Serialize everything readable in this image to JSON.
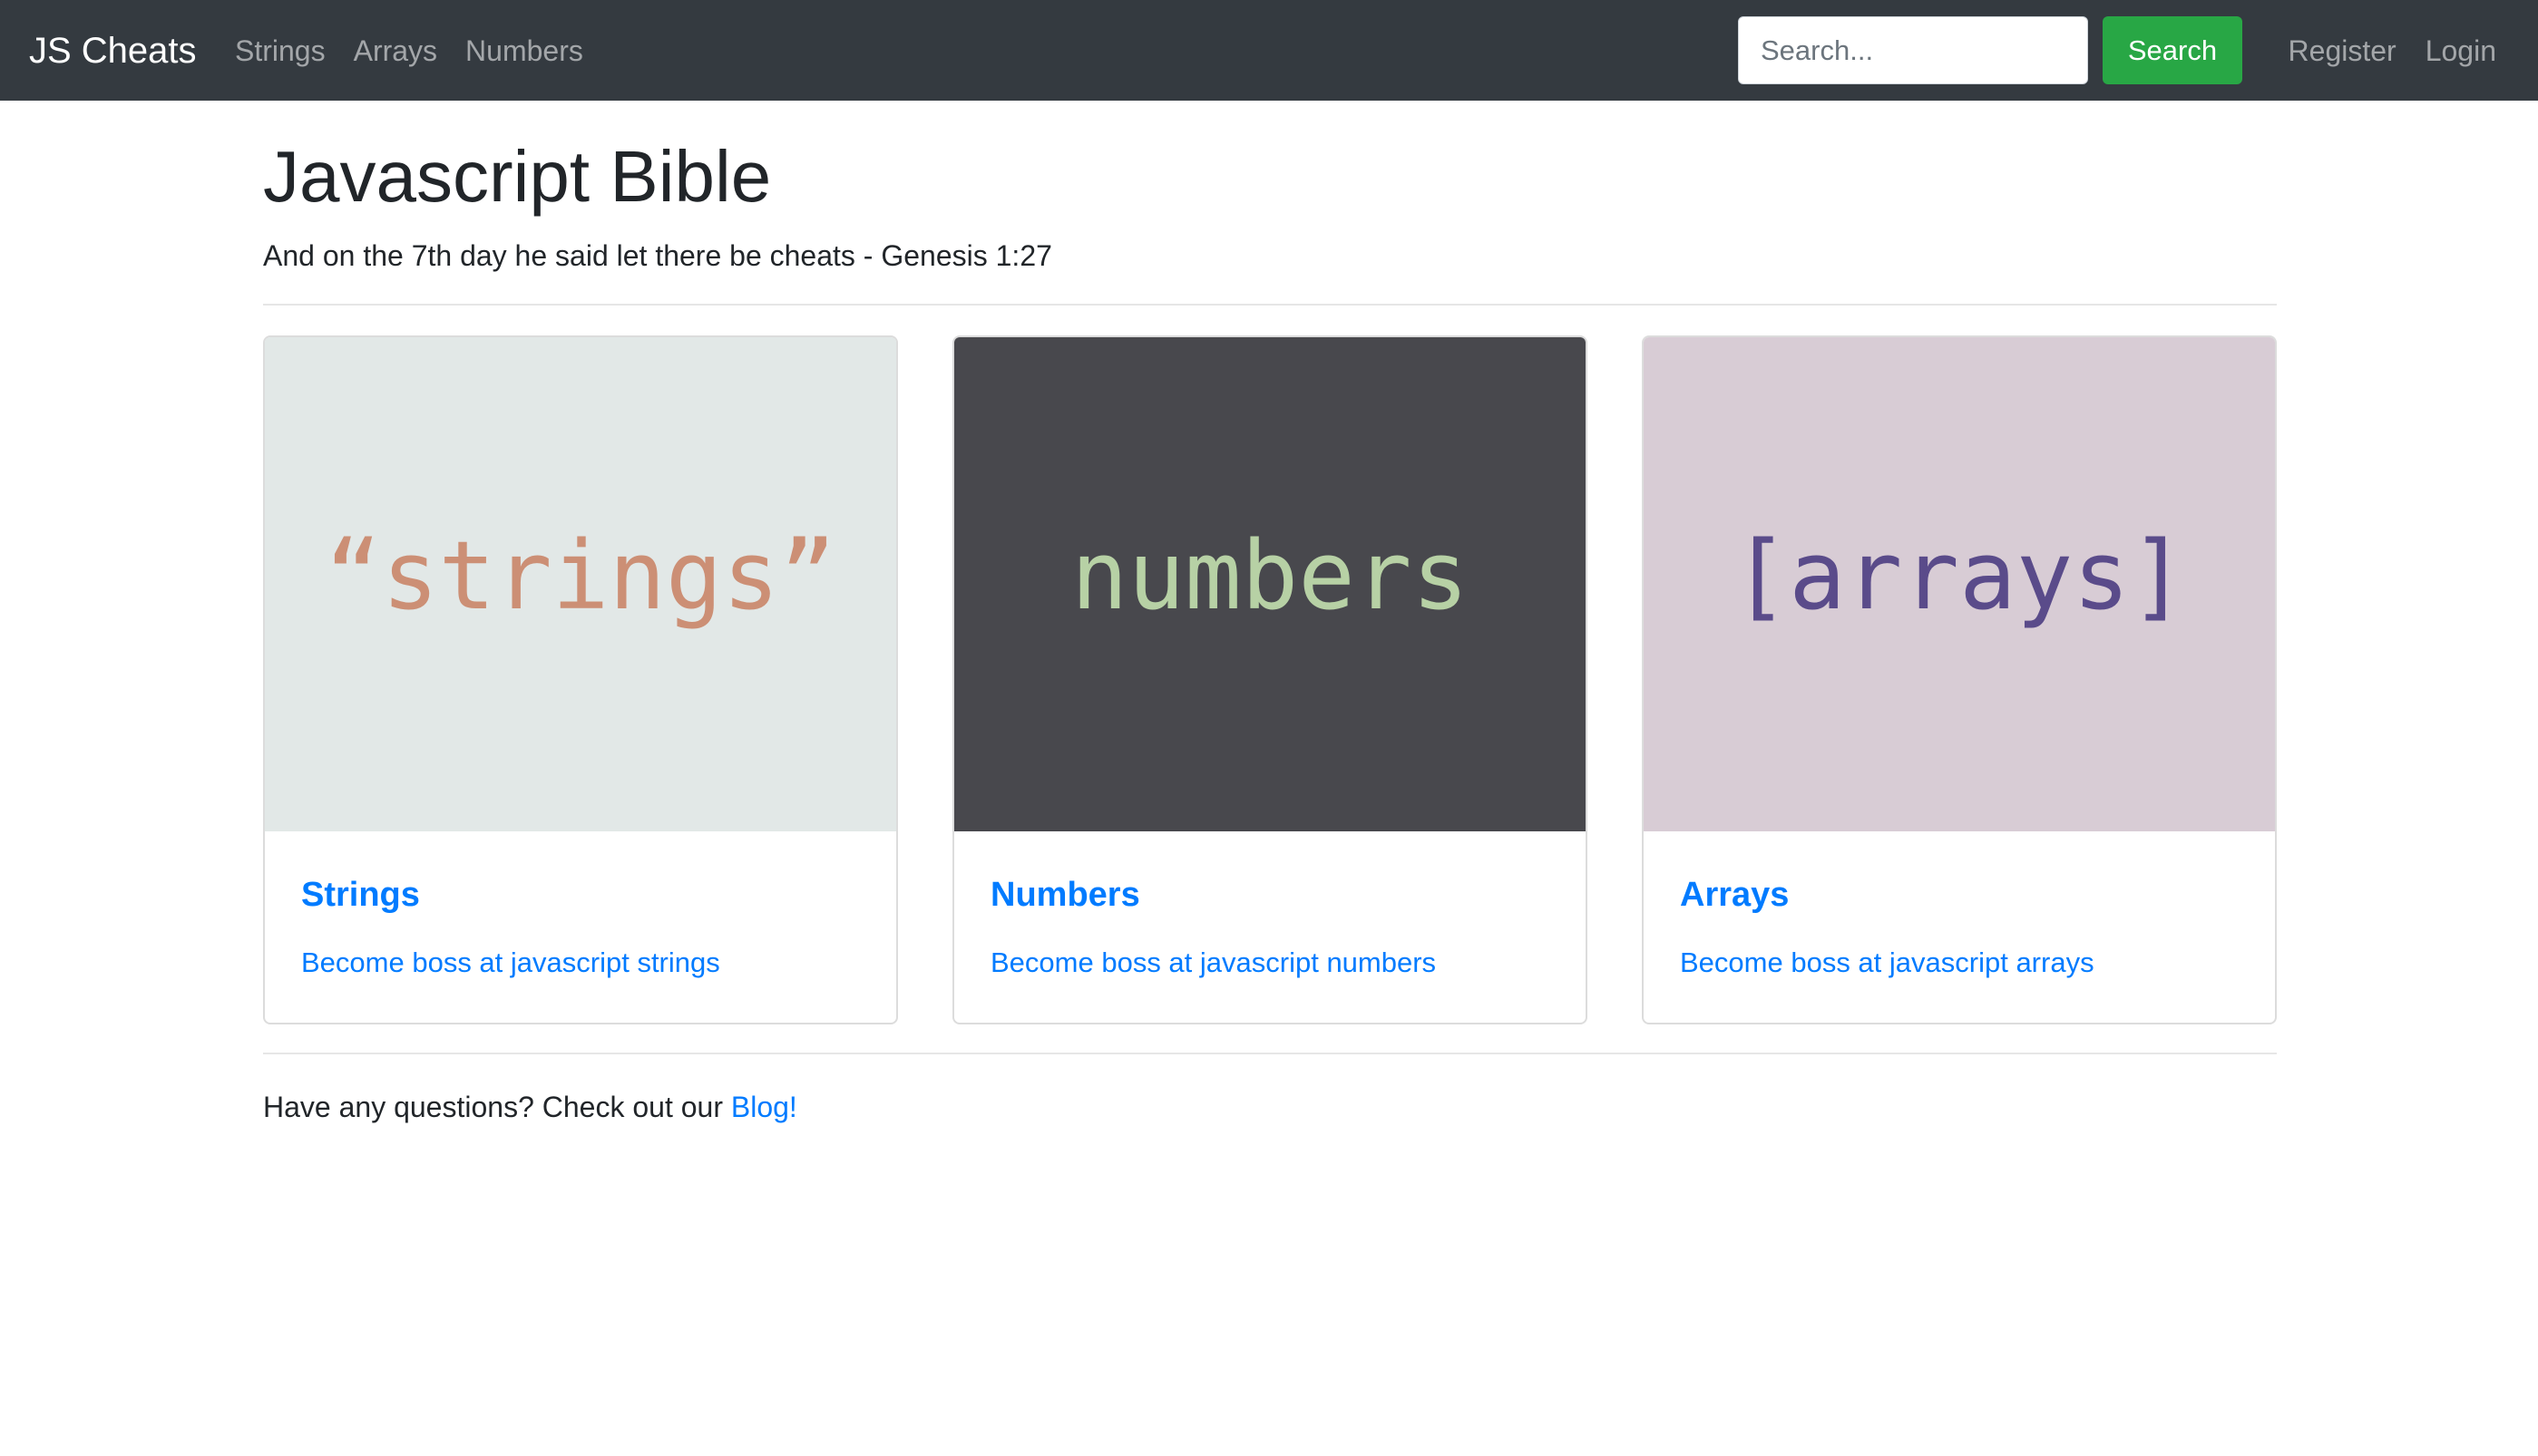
{
  "navbar": {
    "brand": "JS Cheats",
    "links": [
      {
        "label": "Strings"
      },
      {
        "label": "Arrays"
      },
      {
        "label": "Numbers"
      }
    ],
    "search": {
      "placeholder": "Search...",
      "value": "",
      "button_label": "Search"
    },
    "auth": {
      "register_label": "Register",
      "login_label": "Login"
    },
    "colors": {
      "background": "#343a40",
      "search_button": "#28a745"
    }
  },
  "header": {
    "title": "Javascript Bible",
    "subtitle": "And on the 7th day he said let there be cheats - Genesis 1:27"
  },
  "cards": [
    {
      "image_text": "“strings”",
      "image_bg": "#e2e8e7",
      "image_fg": "#cc8f75",
      "title": "Strings",
      "link": "Become boss at javascript strings"
    },
    {
      "image_text": "numbers",
      "image_bg": "#48484d",
      "image_fg": "#b7d1a5",
      "title": "Numbers",
      "link": "Become boss at javascript numbers"
    },
    {
      "image_text": "[arrays]",
      "image_bg": "#d8ccd5",
      "image_fg": "#5a4b8a",
      "title": "Arrays",
      "link": "Become boss at javascript arrays"
    }
  ],
  "footer": {
    "text": "Have any questions? Check out our ",
    "link": "Blog!"
  },
  "colors": {
    "link": "#007bff"
  }
}
